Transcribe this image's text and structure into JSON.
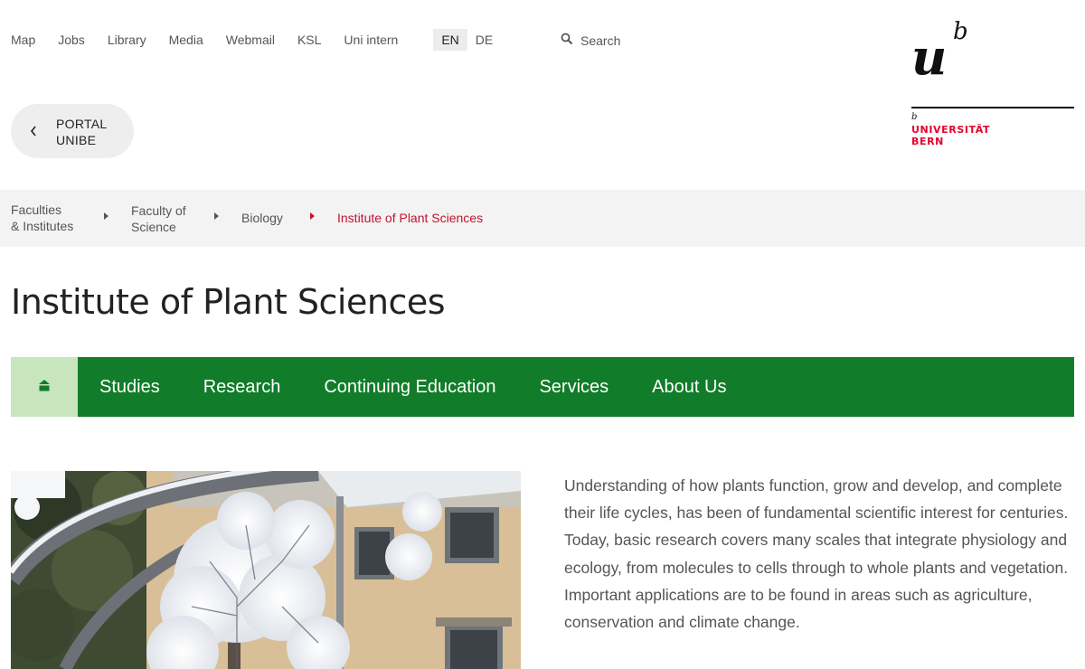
{
  "topnav": {
    "links": [
      "Map",
      "Jobs",
      "Library",
      "Media",
      "Webmail",
      "KSL",
      "Uni intern"
    ],
    "languages": [
      "EN",
      "DE"
    ],
    "active_language": "EN",
    "search_label": "Search"
  },
  "logo": {
    "mark": "u",
    "mark_sup": "b",
    "small_b": "b",
    "line1": "UNIVERSITÄT",
    "line2": "BERN"
  },
  "portal": {
    "line1": "PORTAL",
    "line2": "UNIBE"
  },
  "breadcrumb": [
    {
      "line1": "Faculties",
      "line2": "& Institutes"
    },
    {
      "line1": "Faculty of",
      "line2": "Science"
    },
    {
      "line1": "Biology",
      "line2": ""
    },
    {
      "line1": "Institute of Plant Sciences",
      "line2": ""
    }
  ],
  "page_title": "Institute of Plant Sciences",
  "mainnav": {
    "items": [
      "Studies",
      "Research",
      "Continuing Education",
      "Services",
      "About Us"
    ]
  },
  "intro_text": "Understanding of how plants function, grow and develop, and complete their life cycles, has been of fundamental scientific interest for centuries. Today, basic research covers many scales that integrate physiology and ecology, from molecules to cells through to whole plants and vegetation. Important applications are to be found in areas such as agriculture, conservation and climate change.",
  "colors": {
    "brand_red": "#e3032e",
    "nav_green": "#117c29",
    "home_green_light": "#c7e6be",
    "breadcrumb_bg": "#f3f3f3"
  }
}
